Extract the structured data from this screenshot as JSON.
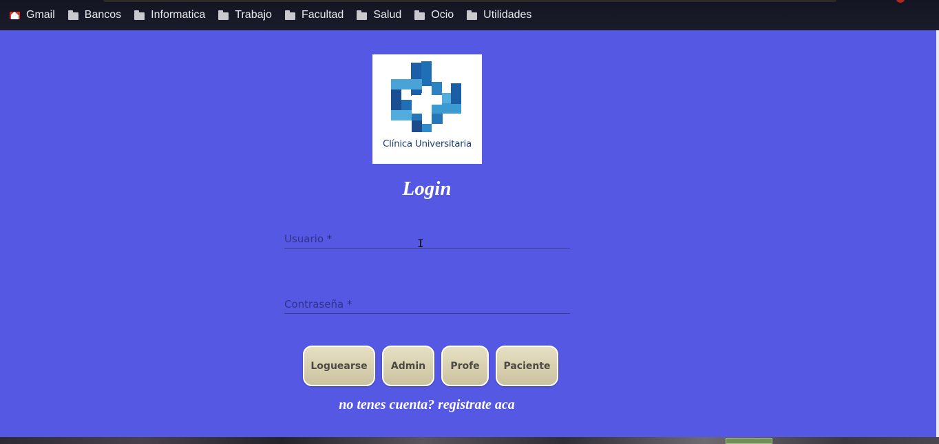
{
  "bookmarks_bar": {
    "items": [
      {
        "label": "Gmail",
        "icon": "gmail-icon"
      },
      {
        "label": "Bancos",
        "icon": "folder-icon"
      },
      {
        "label": "Informatica",
        "icon": "folder-icon"
      },
      {
        "label": "Trabajo",
        "icon": "folder-icon"
      },
      {
        "label": "Facultad",
        "icon": "folder-icon"
      },
      {
        "label": "Salud",
        "icon": "folder-icon"
      },
      {
        "label": "Ocio",
        "icon": "folder-icon"
      },
      {
        "label": "Utilidades",
        "icon": "folder-icon"
      }
    ]
  },
  "logo": {
    "text": "Clínica Universitaria"
  },
  "login": {
    "title": "Login",
    "username_placeholder": "Usuario *",
    "username_value": "",
    "password_placeholder": "Contraseña *",
    "password_value": "",
    "buttons": {
      "login": "Loguearse",
      "admin": "Admin",
      "profe": "Profe",
      "paciente": "Paciente"
    },
    "register_link": "no tenes cuenta? registrate aca"
  },
  "colors": {
    "page_background": "#5558e3",
    "button_background": "#d9d2b3",
    "logo_blue": "#1e6fb5"
  }
}
